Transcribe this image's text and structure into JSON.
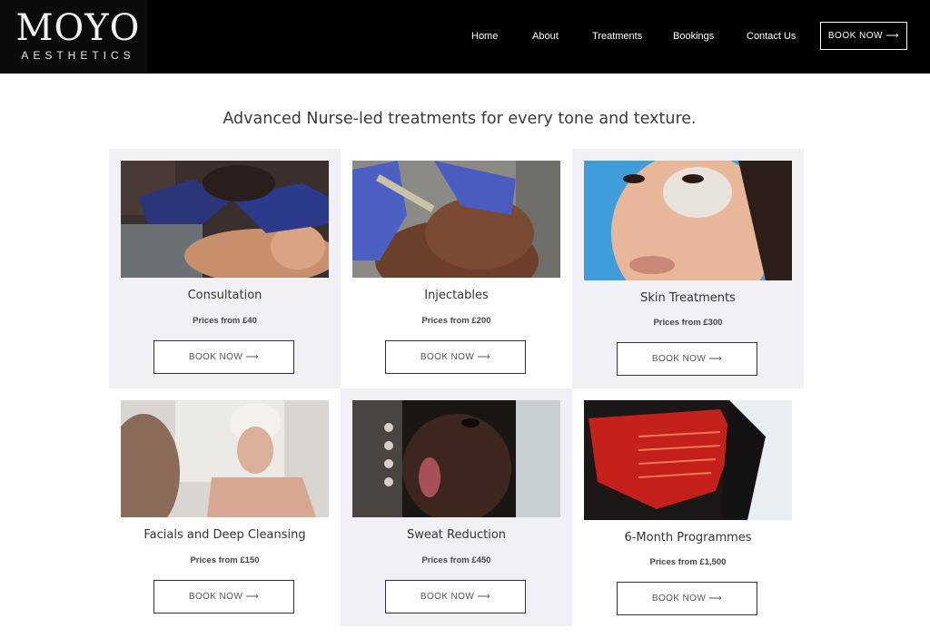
{
  "brand": {
    "name": "MOYO",
    "sub": "AESTHETICS"
  },
  "nav": {
    "items": [
      {
        "label": "Home"
      },
      {
        "label": "About"
      },
      {
        "label": "Treatments"
      },
      {
        "label": "Bookings"
      },
      {
        "label": "Contact Us"
      }
    ],
    "book_label": "BOOK NOW ⟶"
  },
  "headline": "Advanced Nurse-led treatments for every tone and texture.",
  "cards": [
    {
      "title": "Consultation",
      "price": "Prices from £40",
      "button": "BOOK NOW ⟶"
    },
    {
      "title": "Injectables",
      "price": "Prices from £200",
      "button": "BOOK NOW ⟶"
    },
    {
      "title": "Skin Treatments",
      "price": "Prices from £300",
      "button": "BOOK NOW ⟶"
    },
    {
      "title": "Facials and Deep Cleansing",
      "price": "Prices from £150",
      "button": "BOOK NOW ⟶"
    },
    {
      "title": "Sweat Reduction",
      "price": "Prices from £450",
      "button": "BOOK NOW ⟶"
    },
    {
      "title": "6-Month Programmes",
      "price": "Prices from £1,500",
      "button": "BOOK NOW ⟶"
    }
  ],
  "colors": {
    "header_bg": "#000000",
    "card_grey": "#f1f1f5",
    "text": "#333333"
  }
}
